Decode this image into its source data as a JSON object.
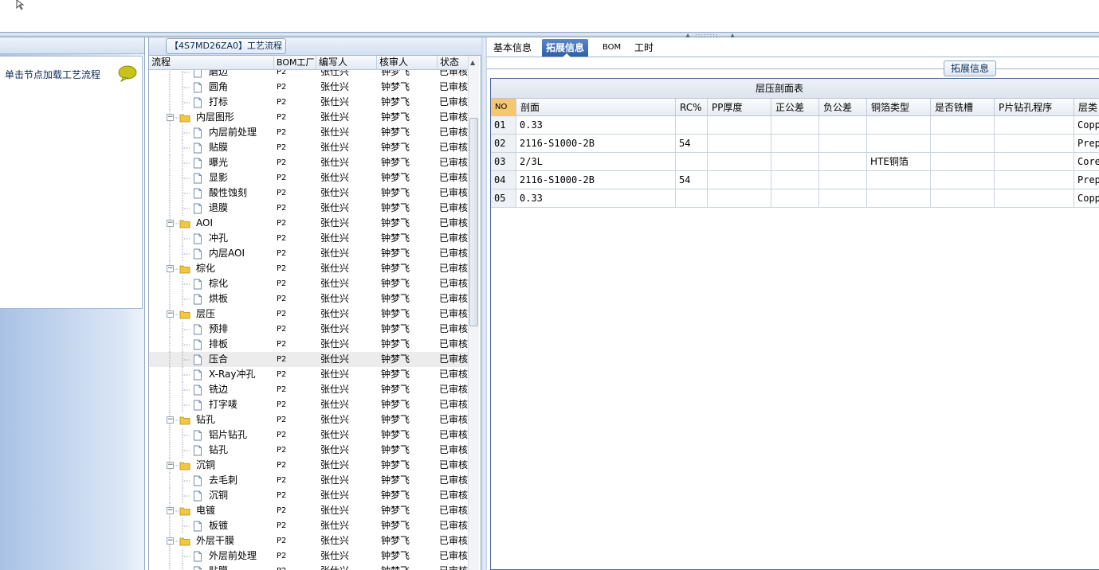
{
  "middle": {
    "title": "【4S7MD26ZA0】工艺流程",
    "columns": [
      "流程",
      "BOM工厂",
      "编写人",
      "核审人",
      "状态"
    ],
    "rows": [
      {
        "name": "磨边",
        "level": 2,
        "type": "file",
        "factory": "P2",
        "writer": "张仕兴",
        "checker": "钟梦飞",
        "status": "已审核",
        "partial": true
      },
      {
        "name": "圆角",
        "level": 2,
        "type": "file",
        "factory": "P2",
        "writer": "张仕兴",
        "checker": "钟梦飞",
        "status": "已审核"
      },
      {
        "name": "打标",
        "level": 2,
        "type": "file",
        "factory": "P2",
        "writer": "张仕兴",
        "checker": "钟梦飞",
        "status": "已审核"
      },
      {
        "name": "内层图形",
        "level": 1,
        "type": "folder",
        "factory": "P2",
        "writer": "张仕兴",
        "checker": "钟梦飞",
        "status": "已审核"
      },
      {
        "name": "内层前处理",
        "level": 2,
        "type": "file",
        "factory": "P2",
        "writer": "张仕兴",
        "checker": "钟梦飞",
        "status": "已审核"
      },
      {
        "name": "贴膜",
        "level": 2,
        "type": "file",
        "factory": "P2",
        "writer": "张仕兴",
        "checker": "钟梦飞",
        "status": "已审核"
      },
      {
        "name": "曝光",
        "level": 2,
        "type": "file",
        "factory": "P2",
        "writer": "张仕兴",
        "checker": "钟梦飞",
        "status": "已审核"
      },
      {
        "name": "显影",
        "level": 2,
        "type": "file",
        "factory": "P2",
        "writer": "张仕兴",
        "checker": "钟梦飞",
        "status": "已审核"
      },
      {
        "name": "酸性蚀刻",
        "level": 2,
        "type": "file",
        "factory": "P2",
        "writer": "张仕兴",
        "checker": "钟梦飞",
        "status": "已审核"
      },
      {
        "name": "退膜",
        "level": 2,
        "type": "file",
        "factory": "P2",
        "writer": "张仕兴",
        "checker": "钟梦飞",
        "status": "已审核"
      },
      {
        "name": "AOI",
        "level": 1,
        "type": "folder",
        "factory": "P2",
        "writer": "张仕兴",
        "checker": "钟梦飞",
        "status": "已审核"
      },
      {
        "name": "冲孔",
        "level": 2,
        "type": "file",
        "factory": "P2",
        "writer": "张仕兴",
        "checker": "钟梦飞",
        "status": "已审核"
      },
      {
        "name": "内层AOI",
        "level": 2,
        "type": "file",
        "factory": "P2",
        "writer": "张仕兴",
        "checker": "钟梦飞",
        "status": "已审核"
      },
      {
        "name": "棕化",
        "level": 1,
        "type": "folder",
        "factory": "P2",
        "writer": "张仕兴",
        "checker": "钟梦飞",
        "status": "已审核"
      },
      {
        "name": "棕化",
        "level": 2,
        "type": "file",
        "factory": "P2",
        "writer": "张仕兴",
        "checker": "钟梦飞",
        "status": "已审核"
      },
      {
        "name": "烘板",
        "level": 2,
        "type": "file",
        "factory": "P2",
        "writer": "张仕兴",
        "checker": "钟梦飞",
        "status": "已审核"
      },
      {
        "name": "层压",
        "level": 1,
        "type": "folder",
        "factory": "P2",
        "writer": "张仕兴",
        "checker": "钟梦飞",
        "status": "已审核"
      },
      {
        "name": "预排",
        "level": 2,
        "type": "file",
        "factory": "P2",
        "writer": "张仕兴",
        "checker": "钟梦飞",
        "status": "已审核"
      },
      {
        "name": "排板",
        "level": 2,
        "type": "file",
        "factory": "P2",
        "writer": "张仕兴",
        "checker": "钟梦飞",
        "status": "已审核"
      },
      {
        "name": "压合",
        "level": 2,
        "type": "file",
        "factory": "P2",
        "writer": "张仕兴",
        "checker": "钟梦飞",
        "status": "已审核",
        "selected": true
      },
      {
        "name": "X-Ray冲孔",
        "level": 2,
        "type": "file",
        "factory": "P2",
        "writer": "张仕兴",
        "checker": "钟梦飞",
        "status": "已审核"
      },
      {
        "name": "铣边",
        "level": 2,
        "type": "file",
        "factory": "P2",
        "writer": "张仕兴",
        "checker": "钟梦飞",
        "status": "已审核"
      },
      {
        "name": "打字唛",
        "level": 2,
        "type": "file",
        "factory": "P2",
        "writer": "张仕兴",
        "checker": "钟梦飞",
        "status": "已审核"
      },
      {
        "name": "钻孔",
        "level": 1,
        "type": "folder",
        "factory": "P2",
        "writer": "张仕兴",
        "checker": "钟梦飞",
        "status": "已审核"
      },
      {
        "name": "铝片钻孔",
        "level": 2,
        "type": "file",
        "factory": "P2",
        "writer": "张仕兴",
        "checker": "钟梦飞",
        "status": "已审核"
      },
      {
        "name": "钻孔",
        "level": 2,
        "type": "file",
        "factory": "P2",
        "writer": "张仕兴",
        "checker": "钟梦飞",
        "status": "已审核"
      },
      {
        "name": "沉铜",
        "level": 1,
        "type": "folder",
        "factory": "P2",
        "writer": "张仕兴",
        "checker": "钟梦飞",
        "status": "已审核"
      },
      {
        "name": "去毛刺",
        "level": 2,
        "type": "file",
        "factory": "P2",
        "writer": "张仕兴",
        "checker": "钟梦飞",
        "status": "已审核"
      },
      {
        "name": "沉铜",
        "level": 2,
        "type": "file",
        "factory": "P2",
        "writer": "张仕兴",
        "checker": "钟梦飞",
        "status": "已审核"
      },
      {
        "name": "电镀",
        "level": 1,
        "type": "folder",
        "factory": "P2",
        "writer": "张仕兴",
        "checker": "钟梦飞",
        "status": "已审核"
      },
      {
        "name": "板镀",
        "level": 2,
        "type": "file",
        "factory": "P2",
        "writer": "张仕兴",
        "checker": "钟梦飞",
        "status": "已审核"
      },
      {
        "name": "外层干膜",
        "level": 1,
        "type": "folder",
        "factory": "P2",
        "writer": "张仕兴",
        "checker": "钟梦飞",
        "status": "已审核"
      },
      {
        "name": "外层前处理",
        "level": 2,
        "type": "file",
        "factory": "P2",
        "writer": "张仕兴",
        "checker": "钟梦飞",
        "status": "已审核"
      },
      {
        "name": "贴膜",
        "level": 2,
        "type": "file",
        "factory": "P2",
        "writer": "张仕兴",
        "checker": "钟梦飞",
        "status": "已审核",
        "partial": true
      }
    ]
  },
  "left": {
    "hint": "单击节点加载工艺流程"
  },
  "right": {
    "tabs": [
      "基本信息",
      "拓展信息",
      "BOM",
      "工时"
    ],
    "active_tab": "拓展信息",
    "section_title": "拓展信息",
    "table_caption": "层压剖面表",
    "columns": [
      "NO",
      "剖面",
      "RC%",
      "PP厚度",
      "正公差",
      "负公差",
      "铜箔类型",
      "是否铣槽",
      "P片钻孔程序",
      "层类"
    ],
    "rows": [
      {
        "no": "01",
        "profile": "0.33",
        "rc": "",
        "pp": "",
        "pos": "",
        "neg": "",
        "foil": "",
        "slot": "",
        "prog": "",
        "type": "Copp"
      },
      {
        "no": "02",
        "profile": "2116-S1000-2B",
        "rc": "54",
        "pp": "",
        "pos": "",
        "neg": "",
        "foil": "",
        "slot": "",
        "prog": "",
        "type": "Prep"
      },
      {
        "no": "03",
        "profile": "2/3L",
        "rc": "",
        "pp": "",
        "pos": "",
        "neg": "",
        "foil": "HTE铜箔",
        "slot": "",
        "prog": "",
        "type": "Core"
      },
      {
        "no": "04",
        "profile": "2116-S1000-2B",
        "rc": "54",
        "pp": "",
        "pos": "",
        "neg": "",
        "foil": "",
        "slot": "",
        "prog": "",
        "type": "Prep"
      },
      {
        "no": "05",
        "profile": "0.33",
        "rc": "",
        "pp": "",
        "pos": "",
        "neg": "",
        "foil": "",
        "slot": "",
        "prog": "",
        "type": "Copp"
      }
    ]
  },
  "colors": {
    "accent": "#2f5fa9",
    "selected_row": "#ececec",
    "no_header": "#f6c86d"
  }
}
